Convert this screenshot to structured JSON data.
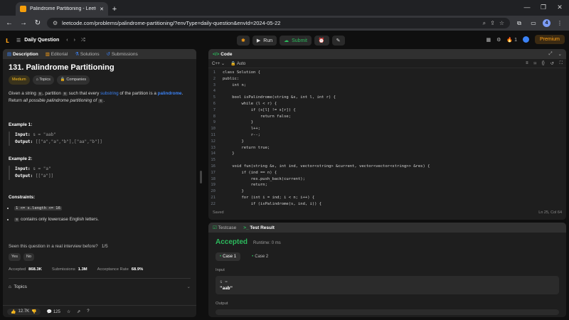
{
  "browser": {
    "tab_title": "Palindrome Partitioning - LeetC",
    "url": "leetcode.com/problems/palindrome-partitioning/?envType=daily-question&envId=2024-05-22",
    "profile_initial": "4"
  },
  "lc": {
    "daily": "Daily Question",
    "run": "Run",
    "submit": "Submit",
    "streak": "1",
    "premium": "Premium"
  },
  "desc": {
    "tabs": [
      "Description",
      "Editorial",
      "Solutions",
      "Submissions"
    ],
    "title": "131. Palindrome Partitioning",
    "difficulty": "Medium",
    "topics": "Topics",
    "companies": "Companies",
    "p1": "Given a string ",
    "p1_code": "s",
    "p1_b": ", partition ",
    "p1_c": "s",
    "p1_d": " such that every ",
    "p1_link": "substring",
    "p1_e": " of the partition is a ",
    "p1_link2": "palindrome",
    "p1_f": ".",
    "p2a": "Return ",
    "p2_all": "all possible palindrome partitioning of ",
    "p2_code": "s",
    "p2_end": ".",
    "ex1_h": "Example 1:",
    "ex1_in_label": "Input:",
    "ex1_in": "s = \"aab\"",
    "ex1_out_label": "Output:",
    "ex1_out": "[[\"a\",\"a\",\"b\"],[\"aa\",\"b\"]]",
    "ex2_h": "Example 2:",
    "ex2_in_label": "Input:",
    "ex2_in": "s = \"a\"",
    "ex2_out_label": "Output:",
    "ex2_out": "[[\"a\"]]",
    "cons_h": "Constraints:",
    "c1": "1 <= s.length <= 16",
    "c2_code": "s",
    "c2": " contains only lowercase English letters.",
    "seen": "Seen this question in a real interview before?",
    "seen_frac": "1/5",
    "yes": "Yes",
    "no": "No",
    "acc_label": "Accepted",
    "acc_val": "868.3K",
    "sub_label": "Submissions",
    "sub_val": "1.3M",
    "rate_label": "Acceptance Rate",
    "rate_val": "68.9%",
    "topics_row": "Topics",
    "likes": "12.7K",
    "comments": "125"
  },
  "code": {
    "header": "Code",
    "lang": "C++",
    "auto": "Auto",
    "saved": "Saved",
    "pos": "Ln 25, Col 64",
    "lines": [
      "class Solution {",
      "public:",
      "    int n;",
      "",
      "    bool isPalindrome(string &s, int l, int r) {",
      "        while (l < r) {",
      "            if (s[l] != s[r]) {",
      "                return false;",
      "            }",
      "            l++;",
      "            r--;",
      "        }",
      "        return true;",
      "    }",
      "",
      "    void fun(string &s, int ind, vector<string> &current, vector<vector<string>> &res) {",
      "        if (ind == n) {",
      "            res.push_back(current);",
      "            return;",
      "        }",
      "        for (int i = ind; i < n; i++) {",
      "            if (isPalindrome(s, ind, i)) {"
    ]
  },
  "result": {
    "testcase": "Testcase",
    "test_result": "Test Result",
    "status": "Accepted",
    "runtime": "Runtime: 0 ms",
    "case1": "Case 1",
    "case2": "Case 2",
    "input_label": "Input",
    "var": "s =",
    "val": "\"aab\"",
    "output_label": "Output"
  }
}
